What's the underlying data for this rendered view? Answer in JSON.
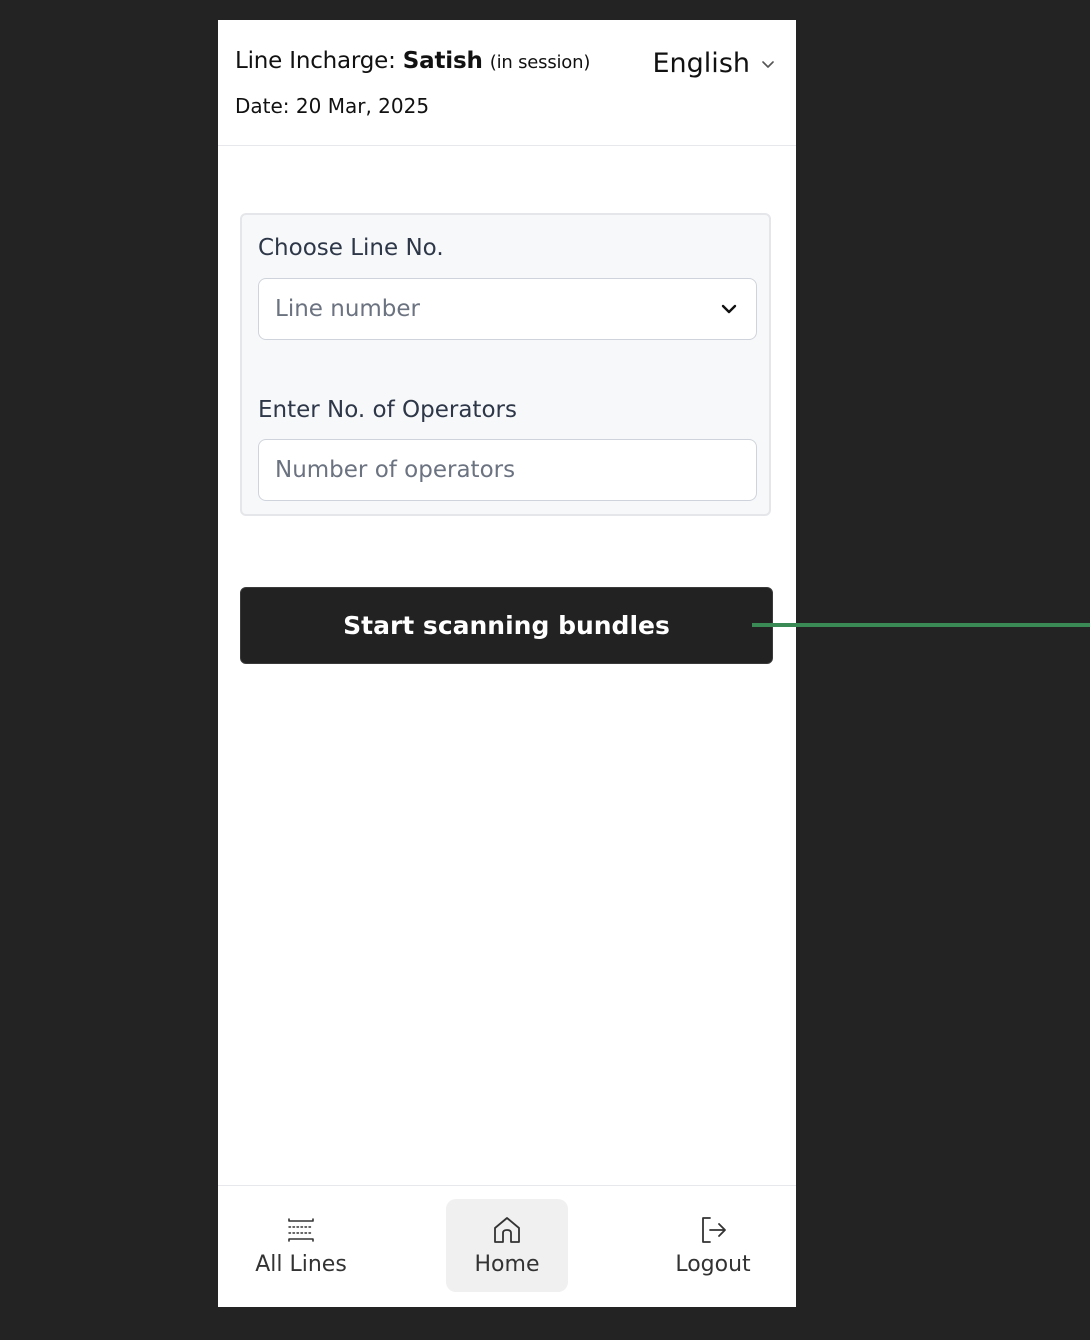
{
  "header": {
    "incharge_prefix": "Line Incharge: ",
    "incharge_name": "Satish",
    "session_note": "(in session)",
    "date_prefix": "Date: ",
    "date_value": "20 Mar, 2025",
    "language": "English"
  },
  "form": {
    "line_label": "Choose Line No.",
    "line_placeholder": "Line number",
    "operators_label": "Enter No. of Operators",
    "operators_placeholder": "Number of operators"
  },
  "actions": {
    "start_label": "Start scanning bundles"
  },
  "nav": {
    "items": [
      {
        "label": "All Lines",
        "icon": "lines-icon"
      },
      {
        "label": "Home",
        "icon": "home-icon",
        "active": true
      },
      {
        "label": "Logout",
        "icon": "logout-icon"
      }
    ]
  },
  "colors": {
    "background": "#232323",
    "button": "#222222",
    "connector": "#3a8a55"
  }
}
